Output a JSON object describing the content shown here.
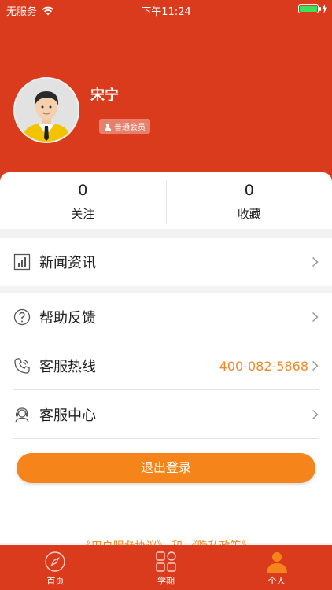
{
  "status_bar": {
    "carrier": "无服务",
    "time": "下午11:24"
  },
  "profile": {
    "name": "宋宁",
    "member_level": "普通会员"
  },
  "stats": [
    {
      "value": "0",
      "label": "关注"
    },
    {
      "value": "0",
      "label": "收藏"
    }
  ],
  "menu": {
    "news": {
      "label": "新闻资讯",
      "icon": "news-chart-icon"
    },
    "help": {
      "label": "帮助反馈",
      "icon": "question-icon"
    },
    "hotline": {
      "label": "客服热线",
      "value": "400-082-5868",
      "icon": "phone-icon"
    },
    "service_center": {
      "label": "客服中心",
      "icon": "headset-icon"
    }
  },
  "logout_label": "退出登录",
  "agreement": {
    "user_agreement": "《用户服务协议》",
    "and": "和",
    "privacy": "《隐私政策》"
  },
  "tabbar": [
    {
      "label": "首页",
      "icon": "compass-icon",
      "active": false
    },
    {
      "label": "学期",
      "icon": "grid-icon",
      "active": false
    },
    {
      "label": "个人",
      "icon": "person-icon",
      "active": true
    }
  ],
  "colors": {
    "primary_red": "#d93b1c",
    "accent_orange": "#f5841a",
    "hotline_orange": "#ef8a2c"
  }
}
